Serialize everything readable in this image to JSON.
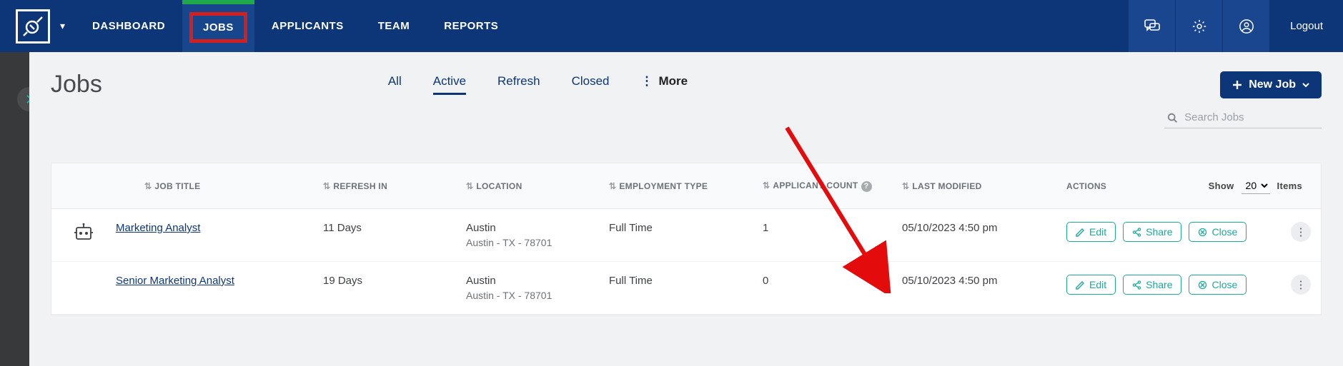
{
  "nav": {
    "dashboard": "DASHBOARD",
    "jobs": "JOBS",
    "applicants": "APPLICANTS",
    "team": "TEAM",
    "reports": "REPORTS",
    "logout": "Logout"
  },
  "page": {
    "title": "Jobs",
    "new_job": "New Job"
  },
  "tabs": {
    "all": "All",
    "active": "Active",
    "refresh": "Refresh",
    "closed": "Closed",
    "more": "More"
  },
  "search": {
    "placeholder": "Search Jobs"
  },
  "columns": {
    "title": "JOB TITLE",
    "refresh": "REFRESH IN",
    "location": "LOCATION",
    "emp_type": "EMPLOYMENT TYPE",
    "app_count": "APPLICANT COUNT",
    "last_mod": "LAST MODIFIED",
    "actions": "ACTIONS"
  },
  "pager": {
    "show": "Show",
    "value": "20",
    "items": "Items"
  },
  "actions": {
    "edit": "Edit",
    "share": "Share",
    "close": "Close"
  },
  "rows": [
    {
      "bot": true,
      "title": "Marketing Analyst",
      "refresh": "11 Days",
      "loc_city": "Austin",
      "loc_full": "Austin - TX - 78701",
      "emp": "Full Time",
      "count": "1",
      "mod": "05/10/2023 4:50 pm"
    },
    {
      "bot": false,
      "title": "Senior Marketing Analyst",
      "refresh": "19 Days",
      "loc_city": "Austin",
      "loc_full": "Austin - TX - 78701",
      "emp": "Full Time",
      "count": "0",
      "mod": "05/10/2023 4:50 pm"
    }
  ]
}
